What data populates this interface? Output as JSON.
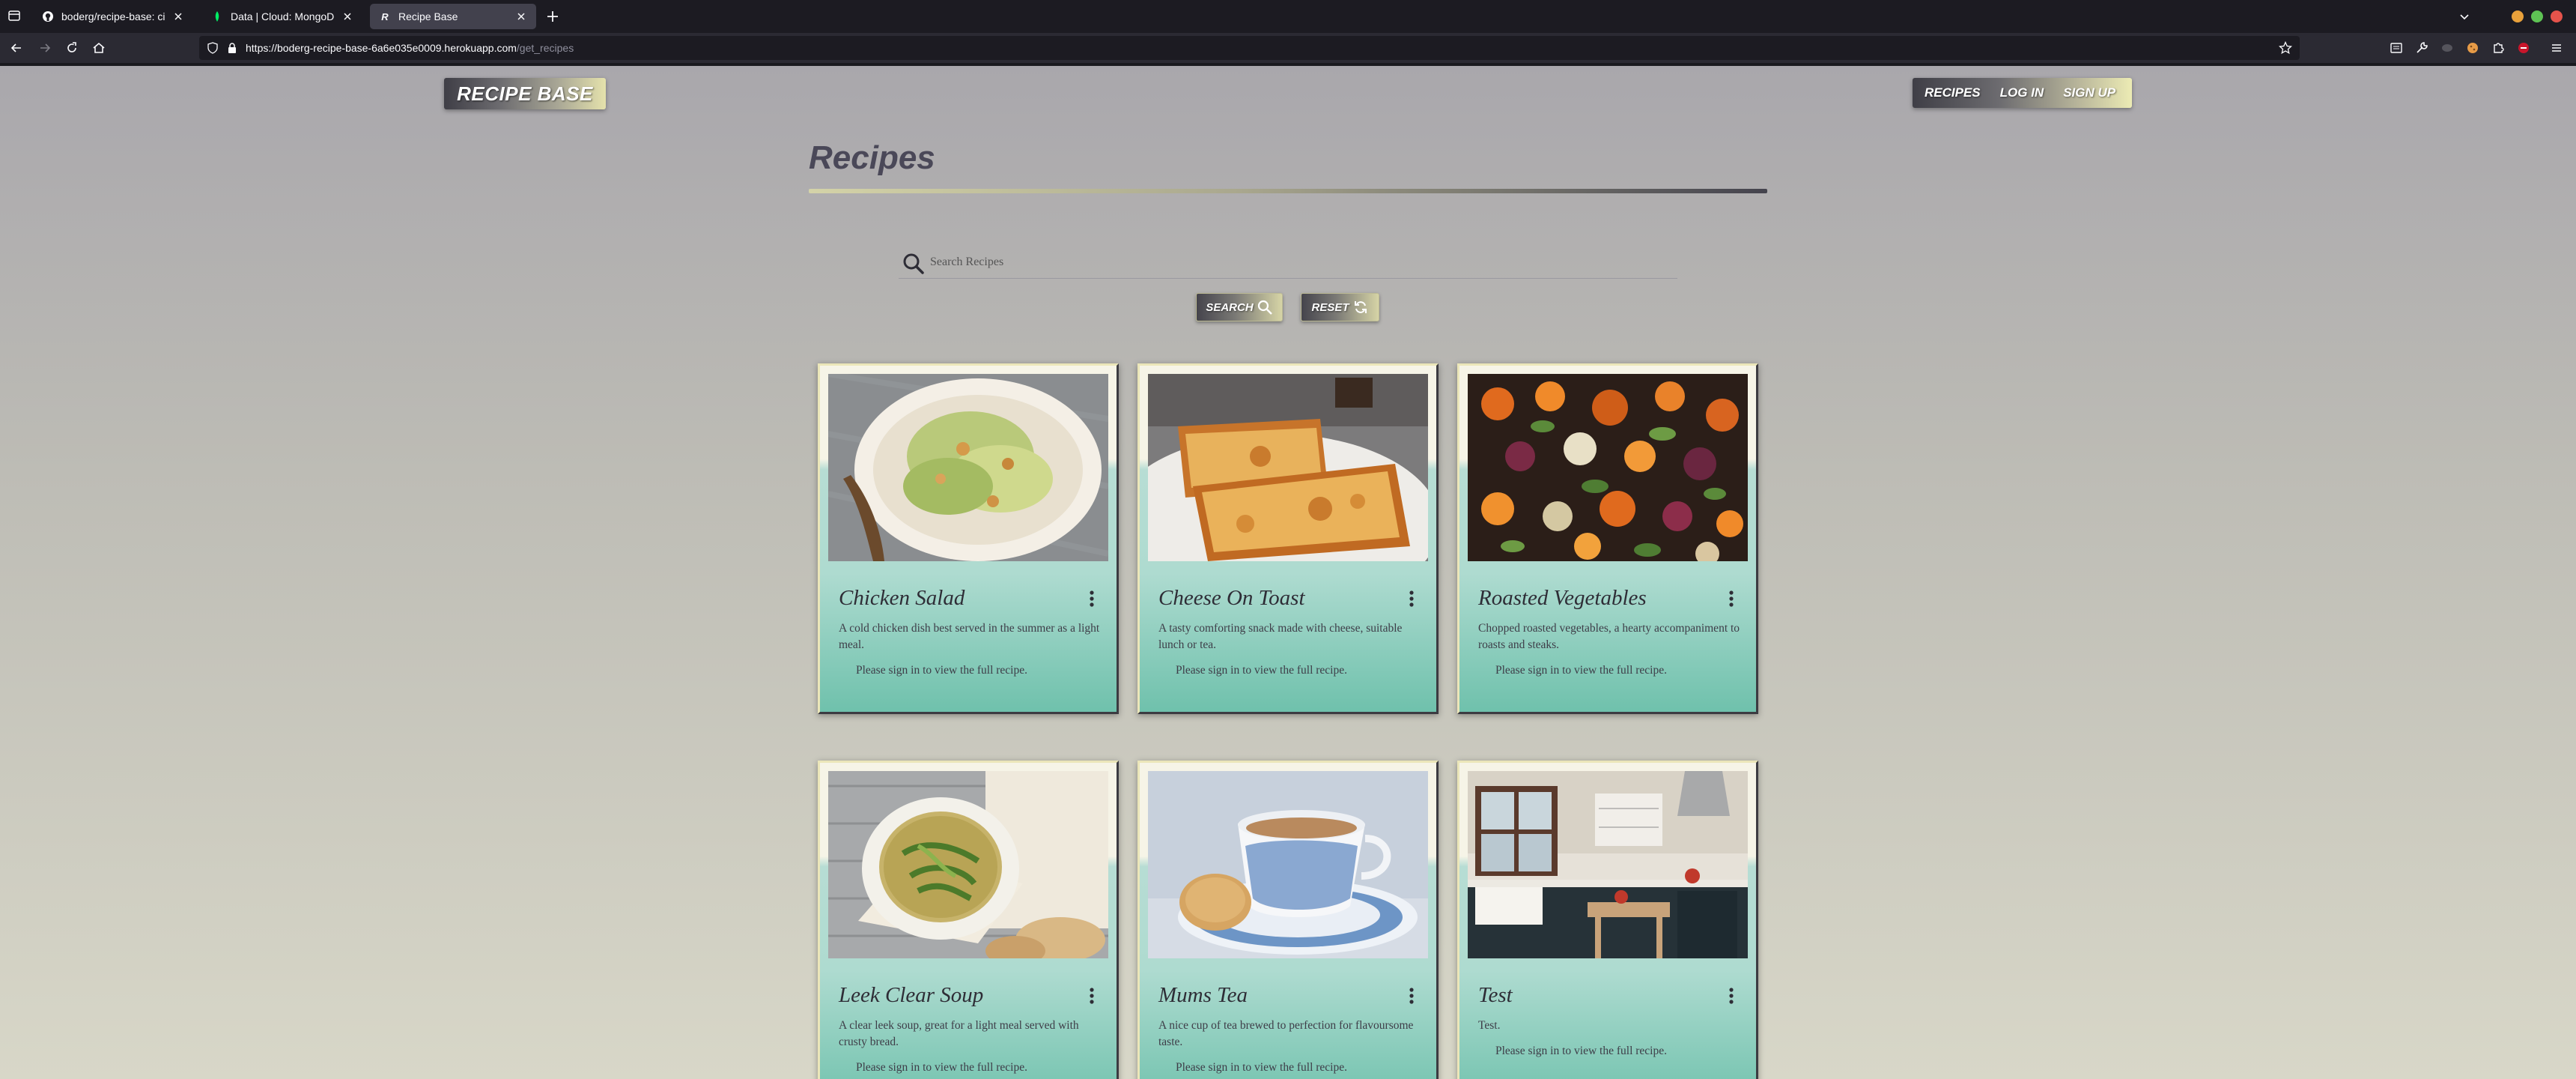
{
  "browser": {
    "tabs": [
      {
        "title": "boderg/recipe-base: ci mile",
        "favicon": "github-icon"
      },
      {
        "title": "Data | Cloud: MongoDB Clo",
        "favicon": "mongodb-leaf-icon"
      },
      {
        "title": "Recipe Base",
        "favicon": "recipe-base-icon",
        "favicon_text": "R"
      }
    ],
    "url_host": "https://boderg-recipe-base-6a6e035e0009.herokuapp.com",
    "url_path": "/get_recipes"
  },
  "site": {
    "brand": "RECIPE BASE",
    "nav": {
      "recipes": "RECIPES",
      "login": "LOG IN",
      "signup": "SIGN UP"
    },
    "accent_gradient": [
      "#3f3e46",
      "#e5e2ac"
    ]
  },
  "main": {
    "title": "Recipes",
    "search": {
      "placeholder": "Search Recipes",
      "value": ""
    },
    "search_button": "SEARCH",
    "reset_button": "RESET"
  },
  "recipes": [
    {
      "name": "Chicken Salad",
      "description": "A cold chicken dish best served in the summer as a light meal.",
      "note": "Please sign in to view the full recipe."
    },
    {
      "name": "Cheese On Toast",
      "description": "A tasty comforting snack made with cheese, suitable lunch or tea.",
      "note": "Please sign in to view the full recipe."
    },
    {
      "name": "Roasted Vegetables",
      "description": "Chopped roasted vegetables, a hearty accompaniment to roasts and steaks.",
      "note": "Please sign in to view the full recipe."
    },
    {
      "name": "Leek Clear Soup",
      "description": "A clear leek soup, great for a light meal served with crusty bread.",
      "note": "Please sign in to view the full recipe."
    },
    {
      "name": "Mums Tea",
      "description": "A nice cup of tea brewed to perfection for flavoursome taste.",
      "note": "Please sign in to view the full recipe."
    },
    {
      "name": "Test",
      "description": "Test.",
      "note": "Please sign in to view the full recipe."
    }
  ]
}
